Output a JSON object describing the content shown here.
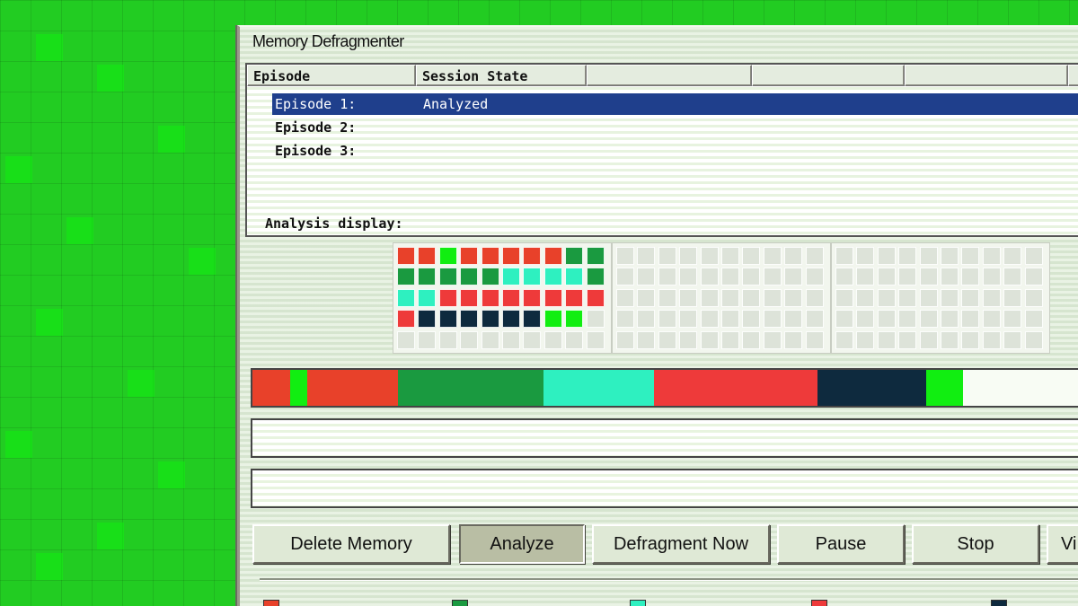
{
  "window": {
    "title": "Memory Defragmenter"
  },
  "listview": {
    "columns": [
      "Episode",
      "Session State",
      "",
      "",
      "",
      ""
    ],
    "rows": [
      {
        "episode": "Episode 1:",
        "state": "Analyzed",
        "selected": true
      },
      {
        "episode": "Episode 2:",
        "state": "",
        "selected": false
      },
      {
        "episode": "Episode 3:",
        "state": "",
        "selected": false
      }
    ]
  },
  "analysis": {
    "label": "Analysis display:",
    "colors": {
      "red": "#e8412a",
      "green": "#1a9a40",
      "bright_green": "#11ee11",
      "aqua": "#2ef0c0",
      "salmon": "#ee3a3a",
      "navy": "#0e2a3e",
      "empty": "#dde3d9"
    },
    "grid_rows": [
      [
        "red",
        "red",
        "bright_green",
        "red",
        "red",
        "red",
        "red",
        "red",
        "green",
        "green"
      ],
      [
        "green",
        "green",
        "green",
        "green",
        "green",
        "aqua",
        "aqua",
        "aqua",
        "aqua",
        "green"
      ],
      [
        "aqua",
        "aqua",
        "salmon",
        "salmon",
        "salmon",
        "salmon",
        "salmon",
        "salmon",
        "salmon",
        "salmon"
      ],
      [
        "salmon",
        "navy",
        "navy",
        "navy",
        "navy",
        "navy",
        "navy",
        "bright_green",
        "bright_green",
        "empty"
      ],
      [
        "empty",
        "empty",
        "empty",
        "empty",
        "empty",
        "empty",
        "empty",
        "empty",
        "empty",
        "empty"
      ]
    ],
    "summary_bar": [
      {
        "color": "red",
        "fraction": 0.044
      },
      {
        "color": "bright_green",
        "fraction": 0.021
      },
      {
        "color": "red",
        "fraction": 0.106
      },
      {
        "color": "green",
        "fraction": 0.171
      },
      {
        "color": "aqua",
        "fraction": 0.13
      },
      {
        "color": "salmon",
        "fraction": 0.193
      },
      {
        "color": "navy",
        "fraction": 0.128
      },
      {
        "color": "bright_green",
        "fraction": 0.043
      }
    ]
  },
  "buttons": {
    "delete": "Delete Memory",
    "analyze": "Analyze",
    "defragment": "Defragment Now",
    "pause": "Pause",
    "stop": "Stop",
    "view": "Vi"
  },
  "legend": [
    "red",
    "green",
    "aqua",
    "salmon",
    "navy"
  ]
}
